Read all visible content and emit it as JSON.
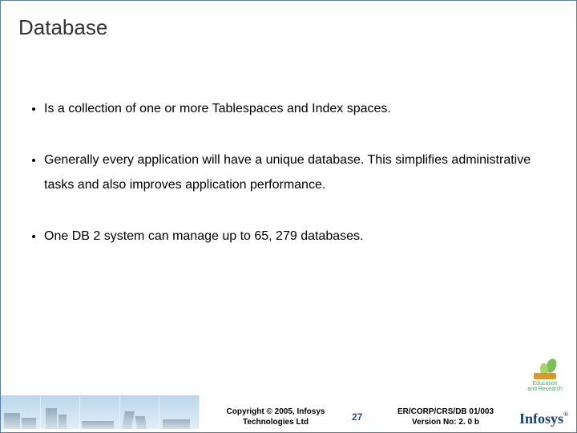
{
  "title": "Database",
  "bullets": [
    "Is a collection of one or more Tablespaces and Index spaces.",
    "Generally every application will have a unique database.  This simplifies administrative tasks and also improves application performance.",
    "One DB 2 system can manage up to 65, 279 databases."
  ],
  "footer": {
    "copyright_line1": "Copyright © 2005, Infosys",
    "copyright_line2": "Technologies Ltd",
    "page_number": "27",
    "ref_line1": "ER/CORP/CRS/DB 01/003",
    "ref_line2": "Version No: 2. 0 b",
    "logo_text": "Infosys",
    "logo_reg": "®",
    "edu_line1": "Education",
    "edu_line2": "and Research"
  }
}
